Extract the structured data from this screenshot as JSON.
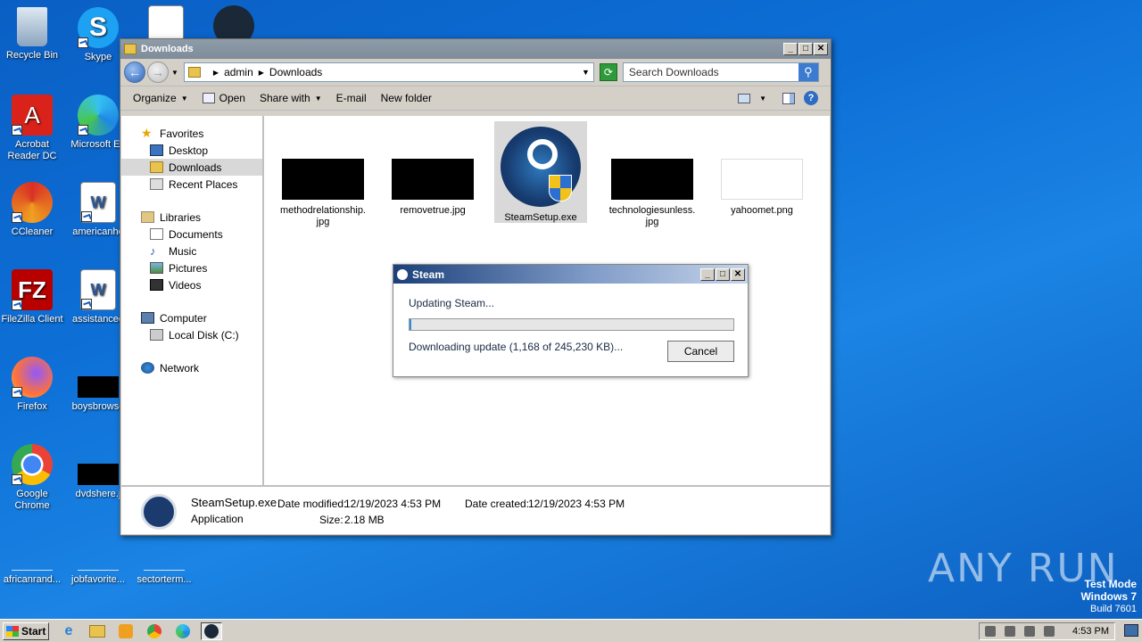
{
  "desktop": {
    "icons": [
      {
        "label": "Recycle Bin"
      },
      {
        "label": "Skype"
      },
      {
        "label": "Acrobat Reader DC"
      },
      {
        "label": "Microsoft Ed"
      },
      {
        "label": "CCleaner"
      },
      {
        "label": "americanho"
      },
      {
        "label": "FileZilla Client"
      },
      {
        "label": "assistanceo"
      },
      {
        "label": "Firefox"
      },
      {
        "label": "boysbrowse"
      },
      {
        "label": "Google Chrome"
      },
      {
        "label": "dvdshere.j"
      },
      {
        "label": "africanrand..."
      },
      {
        "label": "jobfavorite..."
      },
      {
        "label": "sectorterm..."
      }
    ]
  },
  "explorer": {
    "title": "Downloads",
    "breadcrumb": [
      "admin",
      "Downloads"
    ],
    "search_placeholder": "Search Downloads",
    "toolbar": {
      "organize": "Organize",
      "open": "Open",
      "share_with": "Share with",
      "email": "E-mail",
      "new_folder": "New folder"
    },
    "nav": {
      "favorites": "Favorites",
      "desktop": "Desktop",
      "downloads": "Downloads",
      "recent_places": "Recent Places",
      "libraries": "Libraries",
      "documents": "Documents",
      "music": "Music",
      "pictures": "Pictures",
      "videos": "Videos",
      "computer": "Computer",
      "local_disk": "Local Disk (C:)",
      "network": "Network"
    },
    "files": [
      {
        "name": "methodrelationship.\njpg"
      },
      {
        "name": "removetrue.jpg"
      },
      {
        "name": "SteamSetup.exe"
      },
      {
        "name": "technologiesunless.\njpg"
      },
      {
        "name": "yahoomet.png"
      }
    ],
    "details": {
      "name": "SteamSetup.exe",
      "type": "Application",
      "modified_label": "Date modified:",
      "modified": "12/19/2023 4:53 PM",
      "size_label": "Size:",
      "size": "2.18 MB",
      "created_label": "Date created:",
      "created": "12/19/2023 4:53 PM"
    }
  },
  "steam_dialog": {
    "title": "Steam",
    "message": "Updating Steam...",
    "status": "Downloading update (1,168 of 245,230 KB)...",
    "progress_fraction": 0.005,
    "cancel_label": "Cancel"
  },
  "taskbar": {
    "start_label": "Start",
    "clock": "4:53 PM"
  },
  "watermark": {
    "line1": "Test Mode",
    "line2": "Windows 7",
    "line3": "Build 7601",
    "brand": "ANY RUN"
  }
}
